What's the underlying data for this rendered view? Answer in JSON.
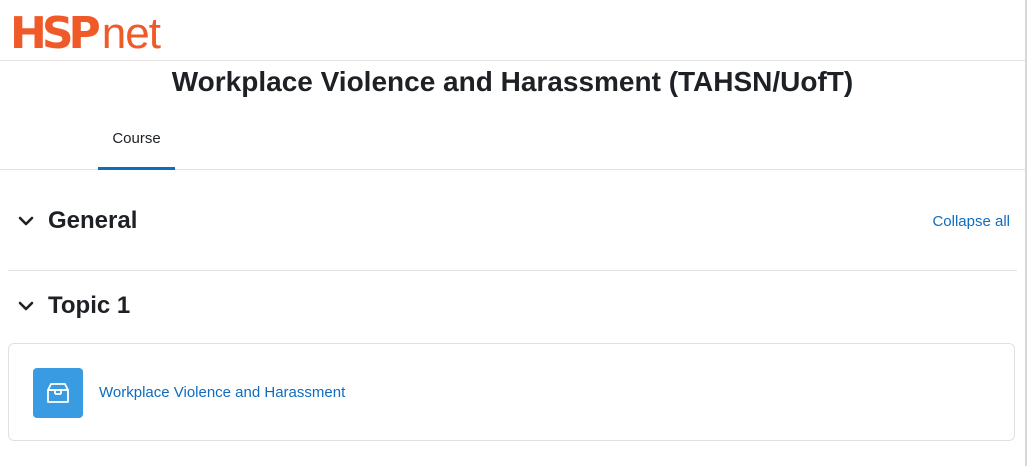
{
  "logo": {
    "brand_primary": "HSP",
    "brand_secondary": "net",
    "color": "#f05a28"
  },
  "course": {
    "title": "Workplace Violence and Harassment (TAHSN/UofT)"
  },
  "nav": {
    "tabs": [
      {
        "label": "Course",
        "active": true
      }
    ]
  },
  "actions": {
    "collapse_all": "Collapse all"
  },
  "sections": [
    {
      "title": "General",
      "expanded": true,
      "icon": "chevron-down-icon",
      "activities": []
    },
    {
      "title": "Topic 1",
      "expanded": true,
      "icon": "chevron-down-icon",
      "activities": [
        {
          "name": "Workplace Violence and Harassment",
          "icon": "package-icon",
          "icon_color": "#399be2"
        }
      ]
    }
  ],
  "colors": {
    "link": "#0f6cbf",
    "active_tab_underline": "#0f6cbf",
    "text": "#1d2125"
  }
}
